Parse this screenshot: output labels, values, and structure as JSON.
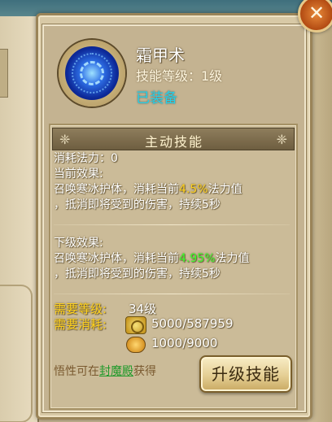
{
  "skill": {
    "name": "霜甲术",
    "level_text": "技能等级：1级",
    "equipped_text": "已装备"
  },
  "section": {
    "title": "主动技能"
  },
  "details": {
    "mana_cost": "消耗法力：0",
    "current_label": "当前效果:",
    "current_line1_pre": "召唤寒冰护体，消耗当前",
    "current_percent": "4.5%",
    "current_line1_post": "法力值",
    "current_line2": "，抵消即将受到的伤害，持续5秒",
    "next_label": "下级效果:",
    "next_line1_pre": "召唤寒冰护体，消耗当前",
    "next_percent": "4.95%",
    "next_line1_post": "法力值",
    "next_line2": "，抵消即将受到的伤害，持续5秒"
  },
  "requirements": {
    "level_label": "需要等级:",
    "level_value": "34级",
    "cost_label": "需要消耗:",
    "coin_value": "5000/587959",
    "item_value": "1000/9000"
  },
  "hint": {
    "prefix": "悟性可在",
    "link": "封魔殿",
    "suffix": "获得"
  },
  "buttons": {
    "upgrade": "升级技能",
    "close": "✕"
  },
  "colors": {
    "highlight": "#ffd21e",
    "next_highlight": "#3cff2a",
    "equipped": "#27d0e8",
    "link": "#1f9a2a"
  }
}
